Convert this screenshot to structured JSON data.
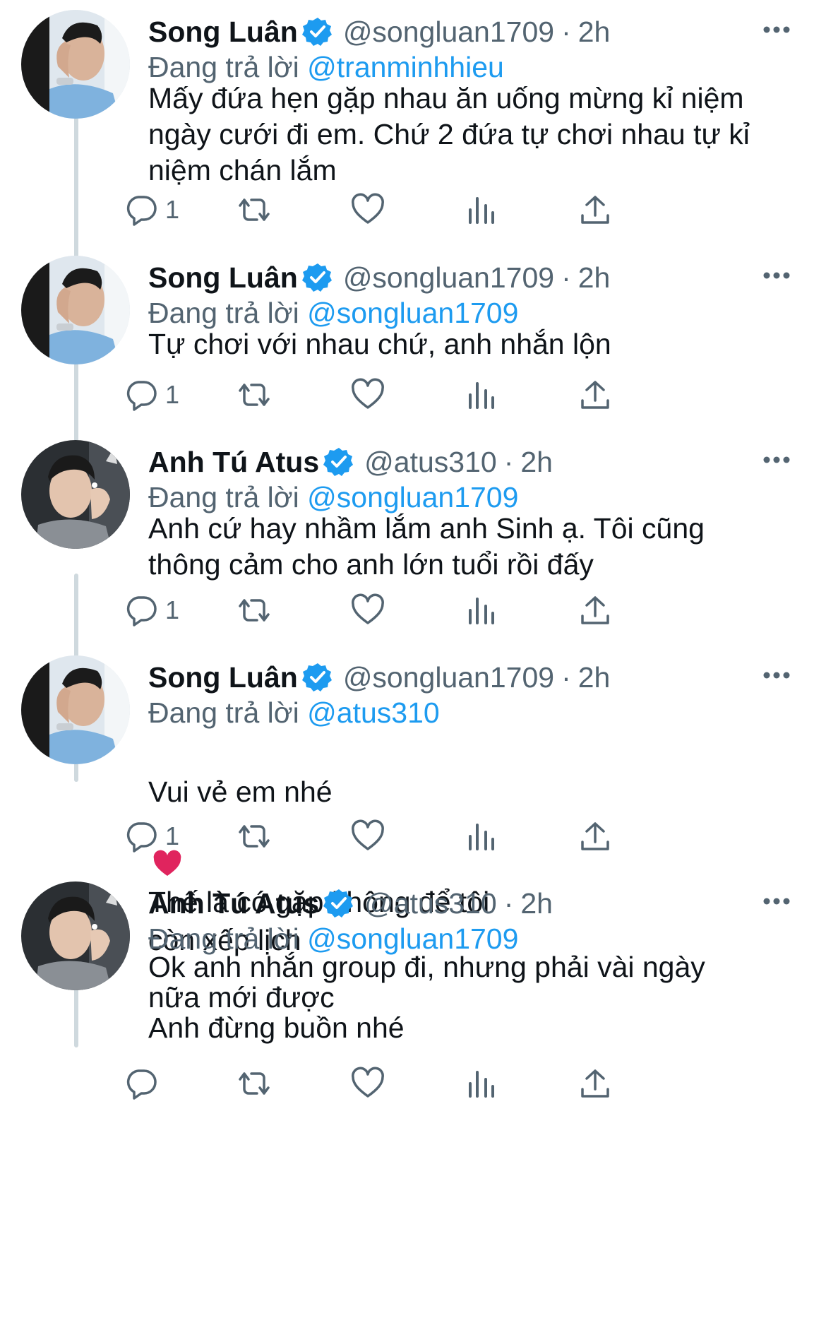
{
  "tweets": [
    {
      "name": "Song Luân",
      "handle": "@songluan1709",
      "separator": "·",
      "time": "2h",
      "reply_prefix": "Đang trả lời",
      "reply_to": "@tranminhhieu",
      "text": "Mấy đứa hẹn gặp nhau ăn uống mừng kỉ niệm\nngày cưới đi em. Chứ 2 đứa tự chơi nhau tự kỉ\nniệm chán lắm",
      "reply_count": "1",
      "avatar": "song-luan-avatar"
    },
    {
      "name": "Song Luân",
      "handle": "@songluan1709",
      "separator": "·",
      "time": "2h",
      "reply_prefix": "Đang trả lời",
      "reply_to": "@songluan1709",
      "text": "Tự chơi với nhau chứ, anh nhắn lộn",
      "reply_count": "1",
      "avatar": "song-luan-avatar"
    },
    {
      "name": "Anh Tú Atus",
      "handle": "@atus310",
      "separator": "·",
      "time": "2h",
      "reply_prefix": "Đang trả lời",
      "reply_to": "@songluan1709",
      "text": "Anh cứ hay nhầm lắm anh Sinh ạ. Tôi cũng\nthông cảm cho anh lớn tuổi rồi đấy",
      "reply_count": "1",
      "avatar": "anh-tu-avatar"
    },
    {
      "name": "Song Luân",
      "handle": "@songluan1709",
      "separator": "·",
      "time": "2h",
      "reply_prefix": "Đang trả lời",
      "reply_to": "@atus310",
      "text_before": "Vui vẻ em nhé",
      "text_after": "Thế là có gặp không để tôi\ncòn xếp lịch",
      "reply_count": "1",
      "avatar": "song-luan-avatar"
    },
    {
      "name": "Anh Tú Atus",
      "handle": "@atus310",
      "separator": "·",
      "time": "2h",
      "reply_prefix": "Đang trả lời",
      "reply_to": "@songluan1709",
      "text": "Ok anh nhắn group đi, nhưng phải vài ngày\nnữa mới được\nAnh đừng buồn nhé",
      "reply_count": "",
      "avatar": "anh-tu-avatar"
    }
  ],
  "icons": {
    "verified": "verified-badge-icon",
    "more": "more-dots-icon",
    "reply": "reply-bubble-icon",
    "retweet": "retweet-icon",
    "like": "heart-icon",
    "views": "bar-chart-icon",
    "share": "share-upload-icon",
    "emoji": "red-heart-emoji"
  },
  "colors": {
    "link": "#1d9bf0",
    "secondary_text": "#536471",
    "thread_line": "#cfd9de"
  }
}
